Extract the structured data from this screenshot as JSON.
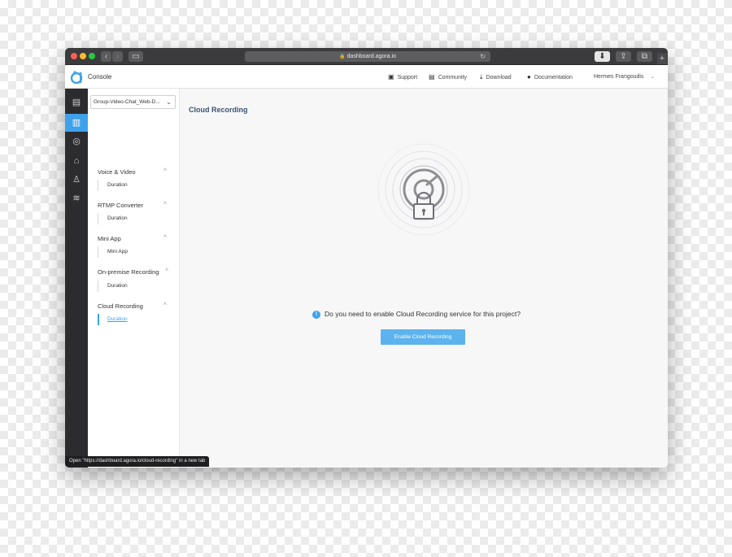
{
  "browser": {
    "url": "dashboard.agora.io",
    "lock_icon": "lock-icon",
    "status_text": "Open \"https://dashboard.agora.io/cloud-recording\" in a new tab"
  },
  "header": {
    "app_label": "Console",
    "nav": [
      {
        "label": "Support",
        "icon": "book-icon"
      },
      {
        "label": "Community",
        "icon": "chat-icon"
      },
      {
        "label": "Download",
        "icon": "download-icon"
      },
      {
        "label": "Documentation",
        "icon": "help-icon"
      }
    ],
    "user_name": "Hermes Frangoudis"
  },
  "rail": {
    "icons": [
      "projects-icon",
      "usage-icon",
      "analytics-icon",
      "home-icon",
      "members-icon",
      "layers-icon"
    ],
    "active_index": 1
  },
  "sidebar": {
    "project_select": "Group-Video-Chat_Web-D...",
    "groups": [
      {
        "title": "Voice & Video",
        "items": [
          "Duration"
        ]
      },
      {
        "title": "RTMP Converter",
        "items": [
          "Duration"
        ]
      },
      {
        "title": "Mini App",
        "items": [
          "Mini App"
        ]
      },
      {
        "title": "On-premise Recording",
        "items": [
          "Duration"
        ]
      },
      {
        "title": "Cloud Recording",
        "items": [
          "Duration"
        ]
      }
    ]
  },
  "main": {
    "title": "Cloud Recording",
    "question": "Do you need to enable Cloud Recording service for this project?",
    "enable_button": "Enable Cloud Recording"
  },
  "colors": {
    "accent": "#3ea1ea",
    "button": "#5cb3ee",
    "rail_bg": "#2c2c2e",
    "title": "#3a5373"
  }
}
